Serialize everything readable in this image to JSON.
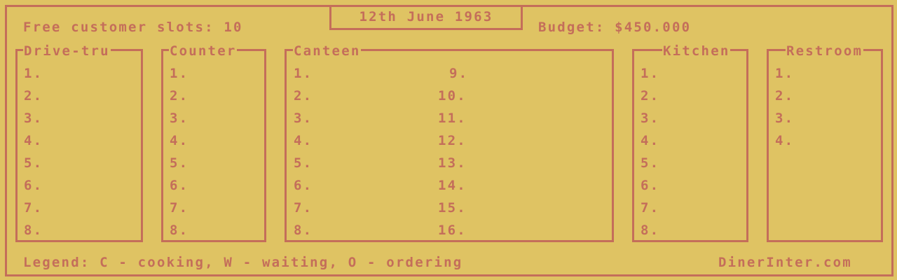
{
  "header": {
    "free_slots_label": "Free customer slots: 10",
    "date": "12th June 1963",
    "budget_label": "Budget: $450.000"
  },
  "panels": {
    "drive": {
      "title": "Drive-tru",
      "slots": [
        "1.",
        "2.",
        "3.",
        "4.",
        "5.",
        "6.",
        "7.",
        "8."
      ]
    },
    "counter": {
      "title": "Counter",
      "slots": [
        "1.",
        "2.",
        "3.",
        "4.",
        "5.",
        "6.",
        "7.",
        "8."
      ]
    },
    "canteen": {
      "title": "Canteen",
      "slots_left": [
        "1.",
        "2.",
        "3.",
        "4.",
        "5.",
        "6.",
        "7.",
        "8."
      ],
      "slots_right": [
        "9.",
        "10.",
        "11.",
        "12.",
        "13.",
        "14.",
        "15.",
        "16."
      ]
    },
    "kitchen": {
      "title": "Kitchen",
      "slots": [
        "1.",
        "2.",
        "3.",
        "4.",
        "5.",
        "6.",
        "7.",
        "8."
      ]
    },
    "restroom": {
      "title": "Restroom",
      "slots": [
        "1.",
        "2.",
        "3.",
        "4."
      ]
    }
  },
  "footer": {
    "legend": "Legend: C - cooking, W - waiting, O - ordering",
    "site": "DinerInter.com"
  },
  "colors": {
    "background": "#dfc363",
    "foreground": "#c46e5a"
  }
}
